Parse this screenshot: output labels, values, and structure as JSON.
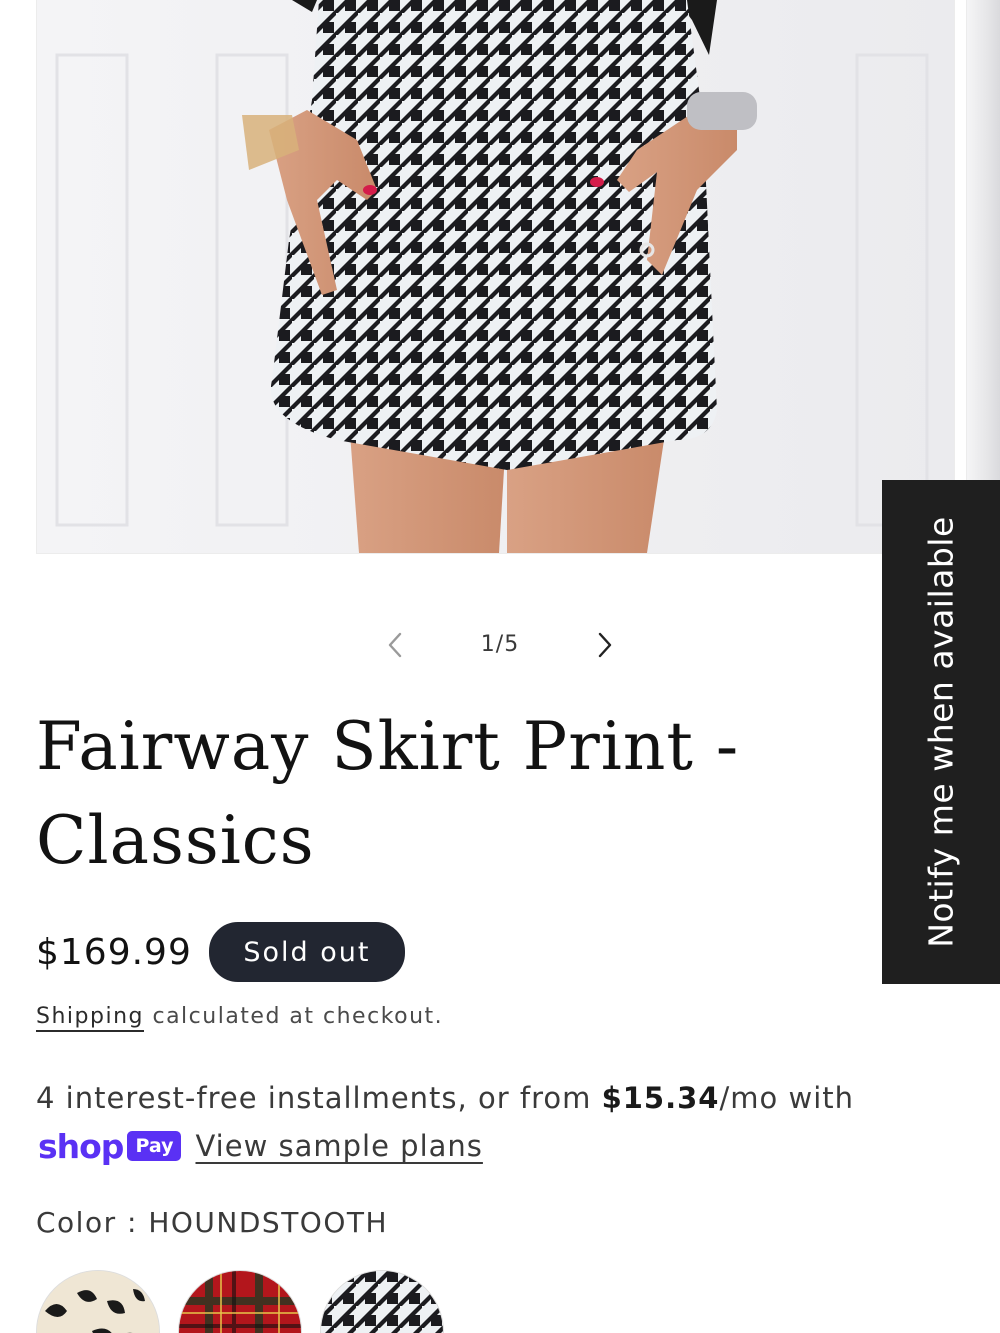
{
  "gallery": {
    "counter": "1/5",
    "prev_icon": "chevron-left-icon",
    "next_icon": "chevron-right-icon"
  },
  "product": {
    "title_line1": "Fairway Skirt Print -",
    "title_line2": "Classics",
    "price": "$169.99",
    "badge": "Sold out"
  },
  "shipping": {
    "link": "Shipping",
    "text": " calculated at checkout."
  },
  "installments": {
    "text_before": "4 interest-free installments, or from ",
    "amount": "$15.34",
    "text_after": "/mo with",
    "shop_word": "shop",
    "pay_word": "Pay",
    "link": "View sample plans"
  },
  "color": {
    "label": "Color : HOUNDSTOOTH",
    "options": [
      "Leopard",
      "Tartan",
      "Houndstooth"
    ]
  },
  "notify": {
    "label": "Notify me when available"
  },
  "colors": {
    "badge_bg": "#222631",
    "shop_pay": "#5a31f4",
    "notify_bg": "#1f1f1f"
  }
}
